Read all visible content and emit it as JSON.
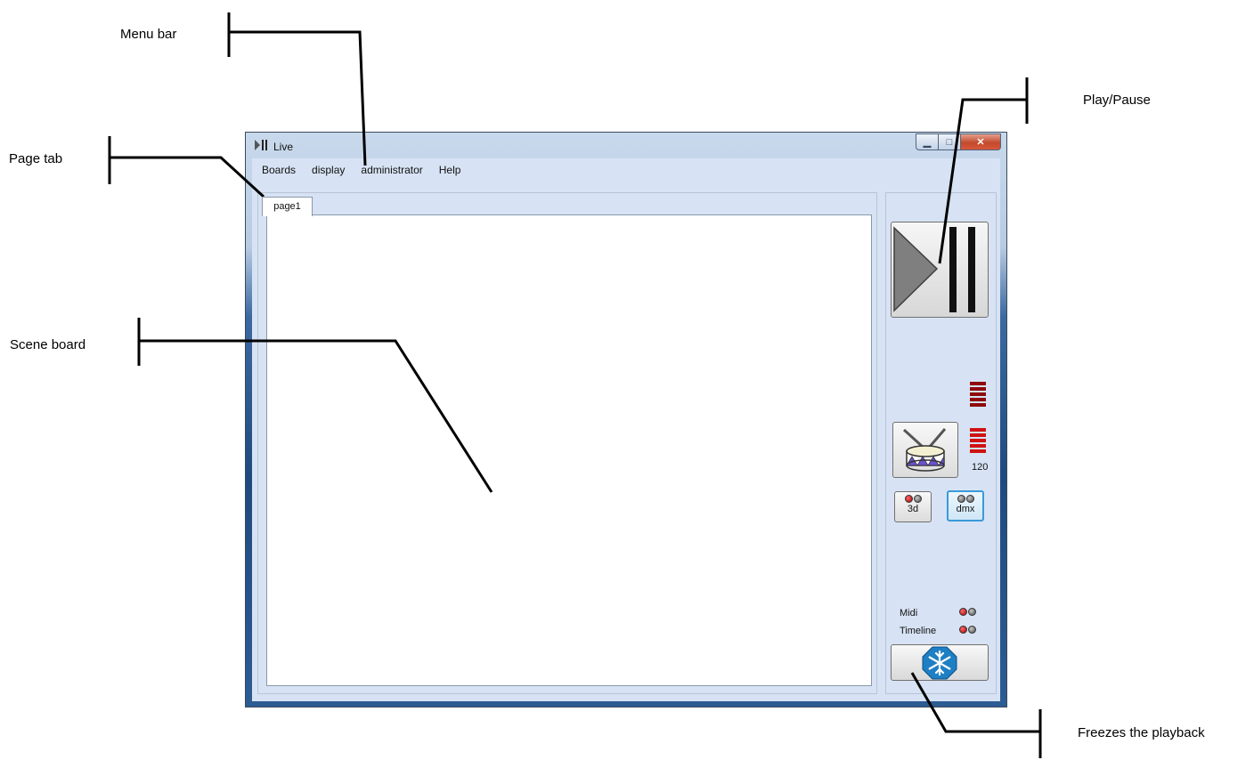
{
  "window": {
    "title": "Live"
  },
  "menu": {
    "items": [
      "Boards",
      "display",
      "administrator",
      "Help"
    ]
  },
  "tabs": [
    {
      "label": "page1"
    }
  ],
  "right_panel": {
    "bpm": "120",
    "mode_buttons": [
      {
        "label": "3d",
        "selected": false
      },
      {
        "label": "dmx",
        "selected": true
      }
    ],
    "status_rows": [
      {
        "label": "Midi"
      },
      {
        "label": "Timeline"
      }
    ]
  },
  "annotations": {
    "menu_bar": "Menu bar",
    "page_tab": "Page tab",
    "scene_board": "Scene board",
    "play_pause": "Play/Pause",
    "freeze": "Freezes the playback"
  },
  "icons": {
    "play_pause": "play-pause-icon",
    "drum": "drum-icon",
    "freeze": "snowflake-icon"
  },
  "colors": {
    "vu_dark": "#8e0b0b",
    "vu_bright": "#cf1212",
    "freeze_blue": "#1f7fc4",
    "selected_border": "#3a9ad8"
  }
}
